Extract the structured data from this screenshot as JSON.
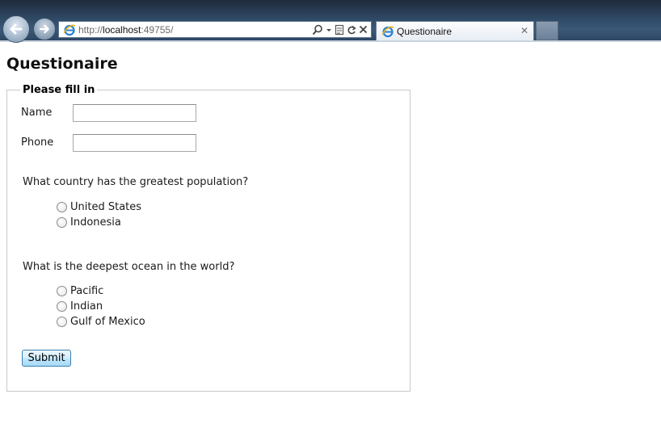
{
  "browser": {
    "url_prefix": "http://",
    "url_host": "localhost",
    "url_rest": ":49755/",
    "tab_title": "Questionaire",
    "icons": {
      "back": "back-arrow-icon",
      "forward": "forward-arrow-icon",
      "page": "ie-page-icon",
      "search": "search-icon",
      "dropdown": "dropdown-icon",
      "compat": "compatibility-view-icon",
      "refresh": "refresh-icon",
      "stop": "stop-icon",
      "close_tab": "close-tab-icon"
    }
  },
  "page": {
    "title": "Questionaire",
    "legend": "Please fill in",
    "fields": {
      "name_label": "Name",
      "name_value": "",
      "phone_label": "Phone",
      "phone_value": ""
    },
    "questions": [
      {
        "text": "What country has the greatest population?",
        "options": [
          "United States",
          "Indonesia"
        ]
      },
      {
        "text": "What is the deepest ocean in the world?",
        "options": [
          "Pacific",
          "Indian",
          "Gulf of Mexico"
        ]
      }
    ],
    "submit_label": "Submit"
  },
  "colors": {
    "chrome_dark": "#1f2a3a",
    "button_border": "#3c7fb1",
    "fieldset_border": "#c9c9c9"
  }
}
